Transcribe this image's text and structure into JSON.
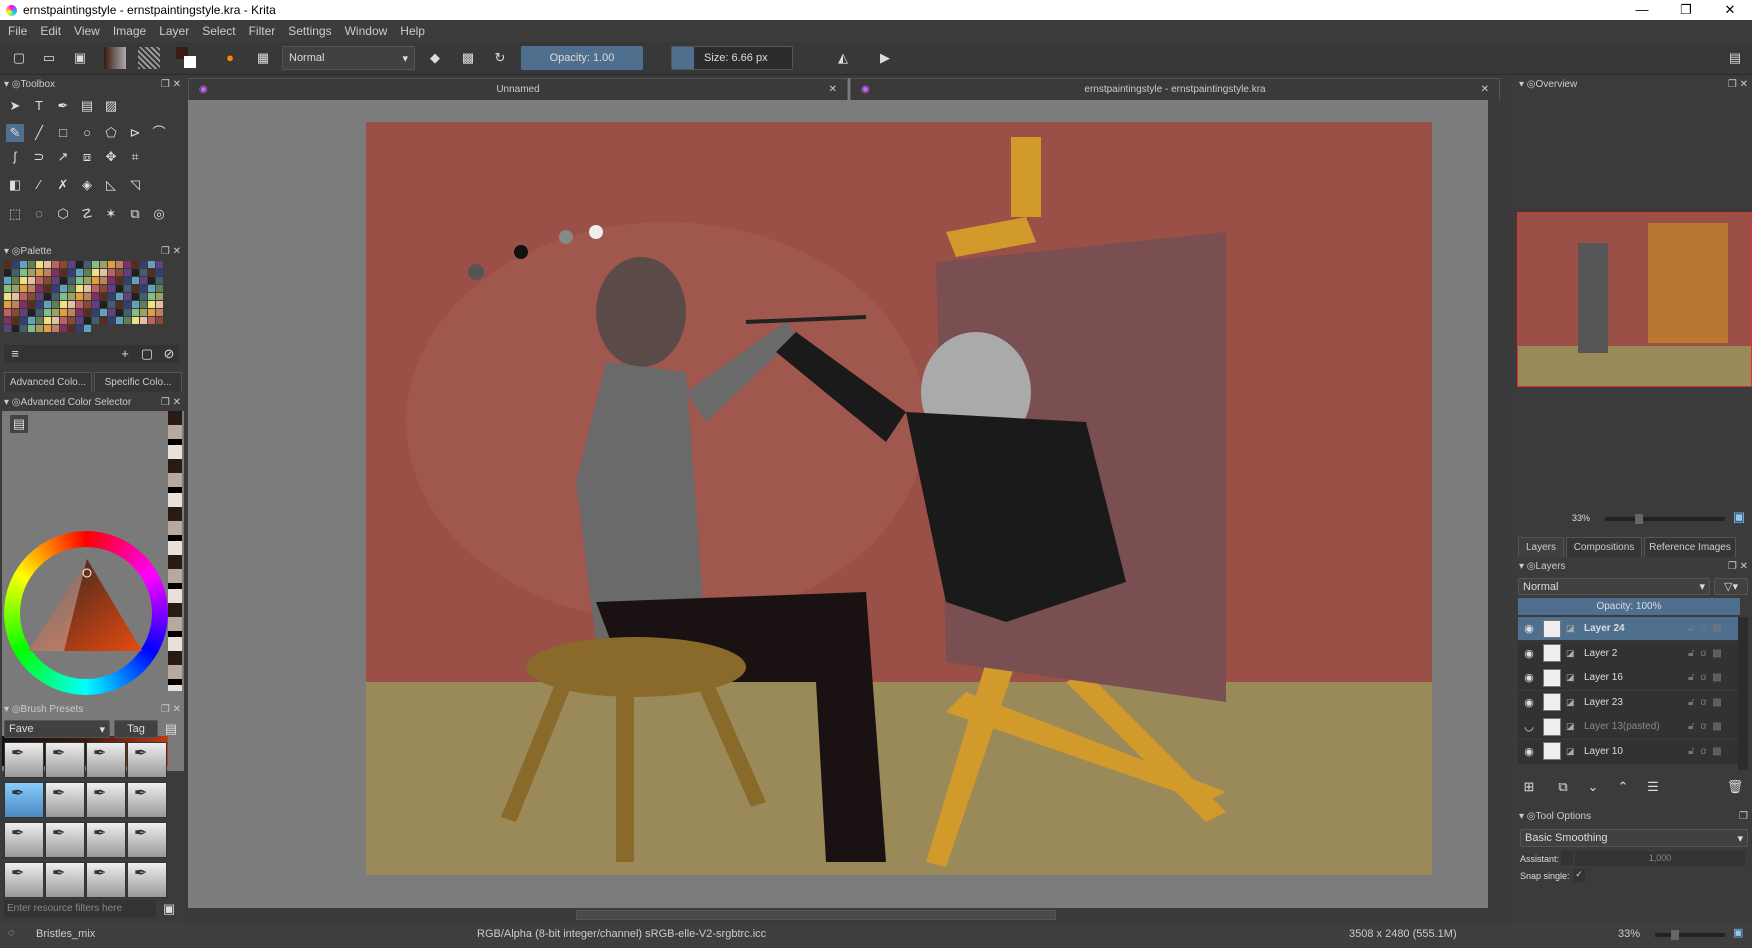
{
  "window": {
    "title": "ernstpaintingstyle - ernstpaintingstyle.kra - Krita",
    "min": "—",
    "max": "❐",
    "close": "✕"
  },
  "menu": [
    "File",
    "Edit",
    "View",
    "Image",
    "Layer",
    "Select",
    "Filter",
    "Settings",
    "Window",
    "Help"
  ],
  "toolbar": {
    "blend_mode": "Normal",
    "opacity": "Opacity:  1.00",
    "size": "Size:  6.66 px"
  },
  "toolbox": {
    "title": "Toolbox"
  },
  "palette": {
    "title": "Palette"
  },
  "color_tabs": [
    "Advanced Colo...",
    "Specific Colo..."
  ],
  "color_selector": {
    "title": "Advanced Color Selector"
  },
  "brush_presets": {
    "title": "Brush Presets",
    "tag_filter": "Fave",
    "tag_button": "Tag",
    "filter_placeholder": "Enter resource filters here"
  },
  "documents": [
    {
      "name": "Unnamed"
    },
    {
      "name": "ernstpaintingstyle - ernstpaintingstyle.kra"
    }
  ],
  "overview": {
    "title": "Overview",
    "zoom": "33%"
  },
  "right_tabs": [
    "Layers",
    "Compositions",
    "Reference Images"
  ],
  "layers": {
    "title": "Layers",
    "blend_mode": "Normal",
    "opacity": "Opacity:  100%",
    "items": [
      {
        "name": "Layer 24",
        "selected": true,
        "visible": true
      },
      {
        "name": "Layer 2",
        "visible": true
      },
      {
        "name": "Layer 16",
        "visible": true
      },
      {
        "name": "Layer 23",
        "visible": true
      },
      {
        "name": "Layer 13(pasted)",
        "visible": false
      },
      {
        "name": "Layer 10",
        "visible": true
      }
    ]
  },
  "tool_options": {
    "title": "Tool Options",
    "smoothing": "Basic Smoothing",
    "assistant_label": "Assistant:",
    "assistant_value": "1,000",
    "snap_label": "Snap single:",
    "snap_checked": "✓"
  },
  "status": {
    "brush": "Bristles_mix",
    "color_space": "RGB/Alpha (8-bit integer/channel)  sRGB-elle-V2-srgbtrc.icc",
    "dimensions": "3508 x 2480 (555.1M)",
    "zoom": "33%"
  },
  "colors": {
    "accent": "#4f6f8f",
    "wall": "#9a4f47",
    "floor": "#9a8a5a"
  }
}
